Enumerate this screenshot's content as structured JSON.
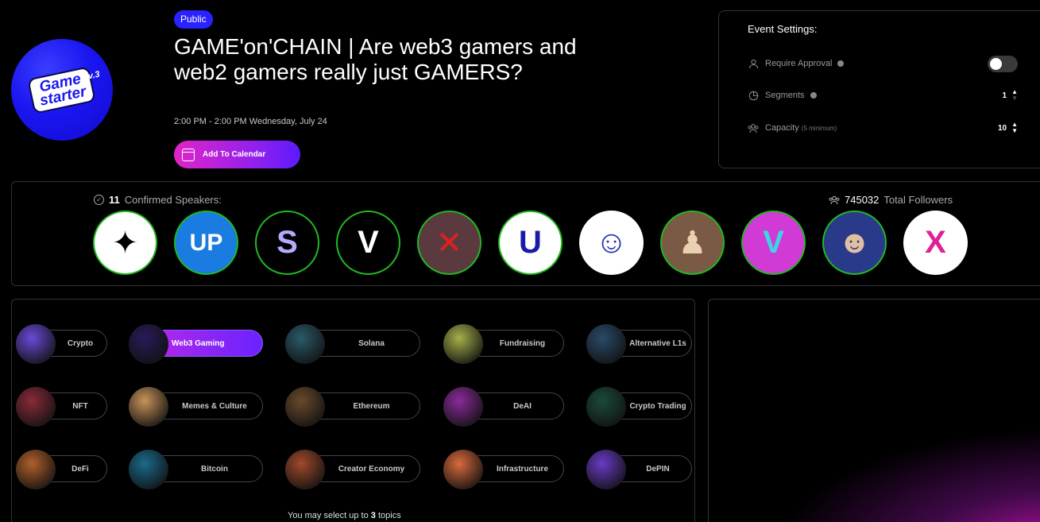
{
  "header": {
    "visibility_badge": "Public",
    "title": "GAME'on'CHAIN | Are web3 gamers and web2 gamers really just GAMERS?",
    "time": "2:00 PM - 2:00 PM Wednesday, July 24",
    "calendar_button": "Add To Calendar",
    "logo": {
      "line1": "Game",
      "line2": "starter",
      "version": "v.3"
    }
  },
  "settings": {
    "title": "Event Settings:",
    "require_approval": {
      "label": "Require Approval",
      "enabled": false
    },
    "segments": {
      "label": "Segments",
      "value": "1"
    },
    "capacity": {
      "label": "Capacity",
      "hint": "(5 minimum)",
      "value": "10"
    }
  },
  "speakers": {
    "count": "11",
    "label": "Confirmed Speakers:",
    "followers_count": "745032",
    "followers_label": "Total Followers",
    "avatars": [
      {
        "name": "speaker-1",
        "bg": "#ffffff",
        "fg": "#000000",
        "glyph": "✦"
      },
      {
        "name": "speaker-2",
        "bg": "#1a7be0",
        "fg": "#ffffff",
        "glyph": "UP"
      },
      {
        "name": "speaker-3",
        "bg": "#000000",
        "fg": "#b9a8ff",
        "glyph": "S"
      },
      {
        "name": "speaker-4",
        "bg": "#000000",
        "fg": "#ffffff",
        "glyph": "V"
      },
      {
        "name": "speaker-5",
        "bg": "#5a3a3f",
        "fg": "#e02020",
        "glyph": "✕"
      },
      {
        "name": "speaker-6",
        "bg": "#ffffff",
        "fg": "#1a1aa8",
        "glyph": "U"
      },
      {
        "name": "speaker-7",
        "bg": "#ffffff",
        "fg": "#2233aa",
        "glyph": "☺"
      },
      {
        "name": "speaker-8",
        "bg": "#7a5a45",
        "fg": "#e8d0b0",
        "glyph": "♟"
      },
      {
        "name": "speaker-9",
        "bg": "#d23ad6",
        "fg": "#3ad6e6",
        "glyph": "V"
      },
      {
        "name": "speaker-10",
        "bg": "#2a3a8a",
        "fg": "#e0c0a0",
        "glyph": "☻"
      },
      {
        "name": "speaker-11",
        "bg": "#ffffff",
        "fg": "#e0209a",
        "glyph": "X"
      }
    ]
  },
  "topics": {
    "items": [
      {
        "label": "Crypto",
        "selected": false,
        "thumb": "#6a4ad8"
      },
      {
        "label": "Web3 Gaming",
        "selected": true,
        "thumb": "#2a1a5a"
      },
      {
        "label": "Solana",
        "selected": false,
        "thumb": "#2a5a6a"
      },
      {
        "label": "Fundraising",
        "selected": false,
        "thumb": "#a7b04a"
      },
      {
        "label": "Alternative L1s",
        "selected": false,
        "thumb": "#2a4a6a"
      },
      {
        "label": "NFT",
        "selected": false,
        "thumb": "#8a2a3a"
      },
      {
        "label": "Memes & Culture",
        "selected": false,
        "thumb": "#c8925a"
      },
      {
        "label": "Ethereum",
        "selected": false,
        "thumb": "#6a4a2a"
      },
      {
        "label": "DeAI",
        "selected": false,
        "thumb": "#8a2a9a"
      },
      {
        "label": "Crypto Trading",
        "selected": false,
        "thumb": "#1a4a3a"
      },
      {
        "label": "DeFi",
        "selected": false,
        "thumb": "#b0602a"
      },
      {
        "label": "Bitcoin",
        "selected": false,
        "thumb": "#1a6a8a"
      },
      {
        "label": "Creator Economy",
        "selected": false,
        "thumb": "#a04a2a"
      },
      {
        "label": "Infrastructure",
        "selected": false,
        "thumb": "#d86a3a"
      },
      {
        "label": "DePIN",
        "selected": false,
        "thumb": "#6a3ac8"
      }
    ],
    "footer_prefix": "You may select up to",
    "footer_count": "3",
    "footer_suffix": "topics"
  }
}
